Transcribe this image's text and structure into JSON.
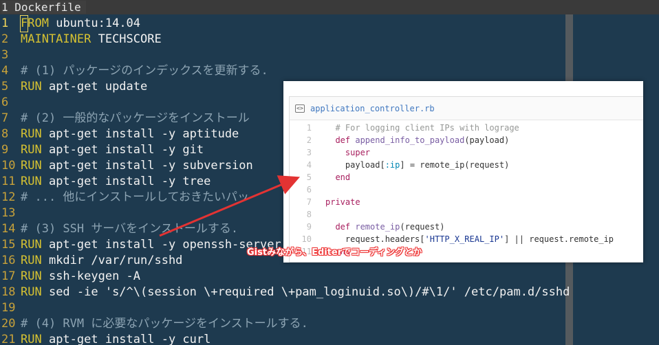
{
  "tab": {
    "number": "1",
    "filename": "Dockerfile"
  },
  "editor_lines": [
    {
      "n": "1",
      "kw": "FROM",
      "rest": " ubuntu:14.04",
      "type": "code"
    },
    {
      "n": "2",
      "kw": "MAINTAINER",
      "rest": " TECHSCORE",
      "type": "code"
    },
    {
      "n": "3",
      "kw": "",
      "rest": "",
      "type": "blank"
    },
    {
      "n": "4",
      "kw": "",
      "rest": "# (1) パッケージのインデックスを更新する.",
      "type": "comment"
    },
    {
      "n": "5",
      "kw": "RUN",
      "rest": " apt-get update",
      "type": "code"
    },
    {
      "n": "6",
      "kw": "",
      "rest": "",
      "type": "blank"
    },
    {
      "n": "7",
      "kw": "",
      "rest": "# (2) 一般的なパッケージをインストール",
      "type": "comment"
    },
    {
      "n": "8",
      "kw": "RUN",
      "rest": " apt-get install -y aptitude",
      "type": "code"
    },
    {
      "n": "9",
      "kw": "RUN",
      "rest": " apt-get install -y git",
      "type": "code"
    },
    {
      "n": "10",
      "kw": "RUN",
      "rest": " apt-get install -y subversion",
      "type": "code"
    },
    {
      "n": "11",
      "kw": "RUN",
      "rest": " apt-get install -y tree",
      "type": "code"
    },
    {
      "n": "12",
      "kw": "",
      "rest": "# ... 他にインストールしておきたいパッ",
      "type": "comment"
    },
    {
      "n": "13",
      "kw": "",
      "rest": "",
      "type": "blank"
    },
    {
      "n": "14",
      "kw": "",
      "rest": "# (3) SSH サーバをインストールする.",
      "type": "comment"
    },
    {
      "n": "15",
      "kw": "RUN",
      "rest": " apt-get install -y openssh-server",
      "type": "code"
    },
    {
      "n": "16",
      "kw": "RUN",
      "rest": " mkdir /var/run/sshd",
      "type": "code"
    },
    {
      "n": "17",
      "kw": "RUN",
      "rest": " ssh-keygen -A",
      "type": "code"
    },
    {
      "n": "18",
      "kw": "RUN",
      "rest": " sed -ie 's/^\\(session \\+required \\+pam_loginuid.so\\)/#\\1/' /etc/pam.d/sshd",
      "type": "code"
    },
    {
      "n": "19",
      "kw": "",
      "rest": "",
      "type": "blank"
    },
    {
      "n": "20",
      "kw": "",
      "rest": "# (4) RVM に必要なパッケージをインストールする.",
      "type": "comment"
    },
    {
      "n": "21",
      "kw": "RUN",
      "rest": " apt-get install -y curl",
      "type": "code"
    }
  ],
  "gist": {
    "icon": "code-file-icon",
    "filename": "application_controller.rb",
    "lines": [
      {
        "n": "1",
        "parts": [
          [
            "  ",
            "plain"
          ],
          [
            "# For logging client IPs with lograge",
            "cmt"
          ]
        ]
      },
      {
        "n": "2",
        "parts": [
          [
            "  ",
            "plain"
          ],
          [
            "def ",
            "kw"
          ],
          [
            "append_info_to_payload",
            "fn"
          ],
          [
            "(payload)",
            "plain"
          ]
        ]
      },
      {
        "n": "3",
        "parts": [
          [
            "    ",
            "plain"
          ],
          [
            "super",
            "kw"
          ]
        ]
      },
      {
        "n": "4",
        "parts": [
          [
            "    payload[",
            "plain"
          ],
          [
            ":ip",
            "sym"
          ],
          [
            "] = remote_ip(request)",
            "plain"
          ]
        ]
      },
      {
        "n": "5",
        "parts": [
          [
            "  ",
            "plain"
          ],
          [
            "end",
            "kw"
          ]
        ]
      },
      {
        "n": "6",
        "parts": [
          [
            "",
            "plain"
          ]
        ]
      },
      {
        "n": "7",
        "parts": [
          [
            "private",
            "kw"
          ]
        ]
      },
      {
        "n": "8",
        "parts": [
          [
            "",
            "plain"
          ]
        ]
      },
      {
        "n": "9",
        "parts": [
          [
            "  ",
            "plain"
          ],
          [
            "def ",
            "kw"
          ],
          [
            "remote_ip",
            "fn"
          ],
          [
            "(request)",
            "plain"
          ]
        ]
      },
      {
        "n": "10",
        "parts": [
          [
            "    request.headers[",
            "plain"
          ],
          [
            "'HTTP_X_REAL_IP'",
            "str"
          ],
          [
            "] || request.remote_ip",
            "plain"
          ]
        ]
      },
      {
        "n": "11",
        "parts": [
          [
            "  ",
            "plain"
          ],
          [
            "end",
            "kw"
          ]
        ]
      }
    ]
  },
  "annotation": {
    "text": "Gistみながら、Editerでコーディングとか",
    "color": "#e33333"
  }
}
